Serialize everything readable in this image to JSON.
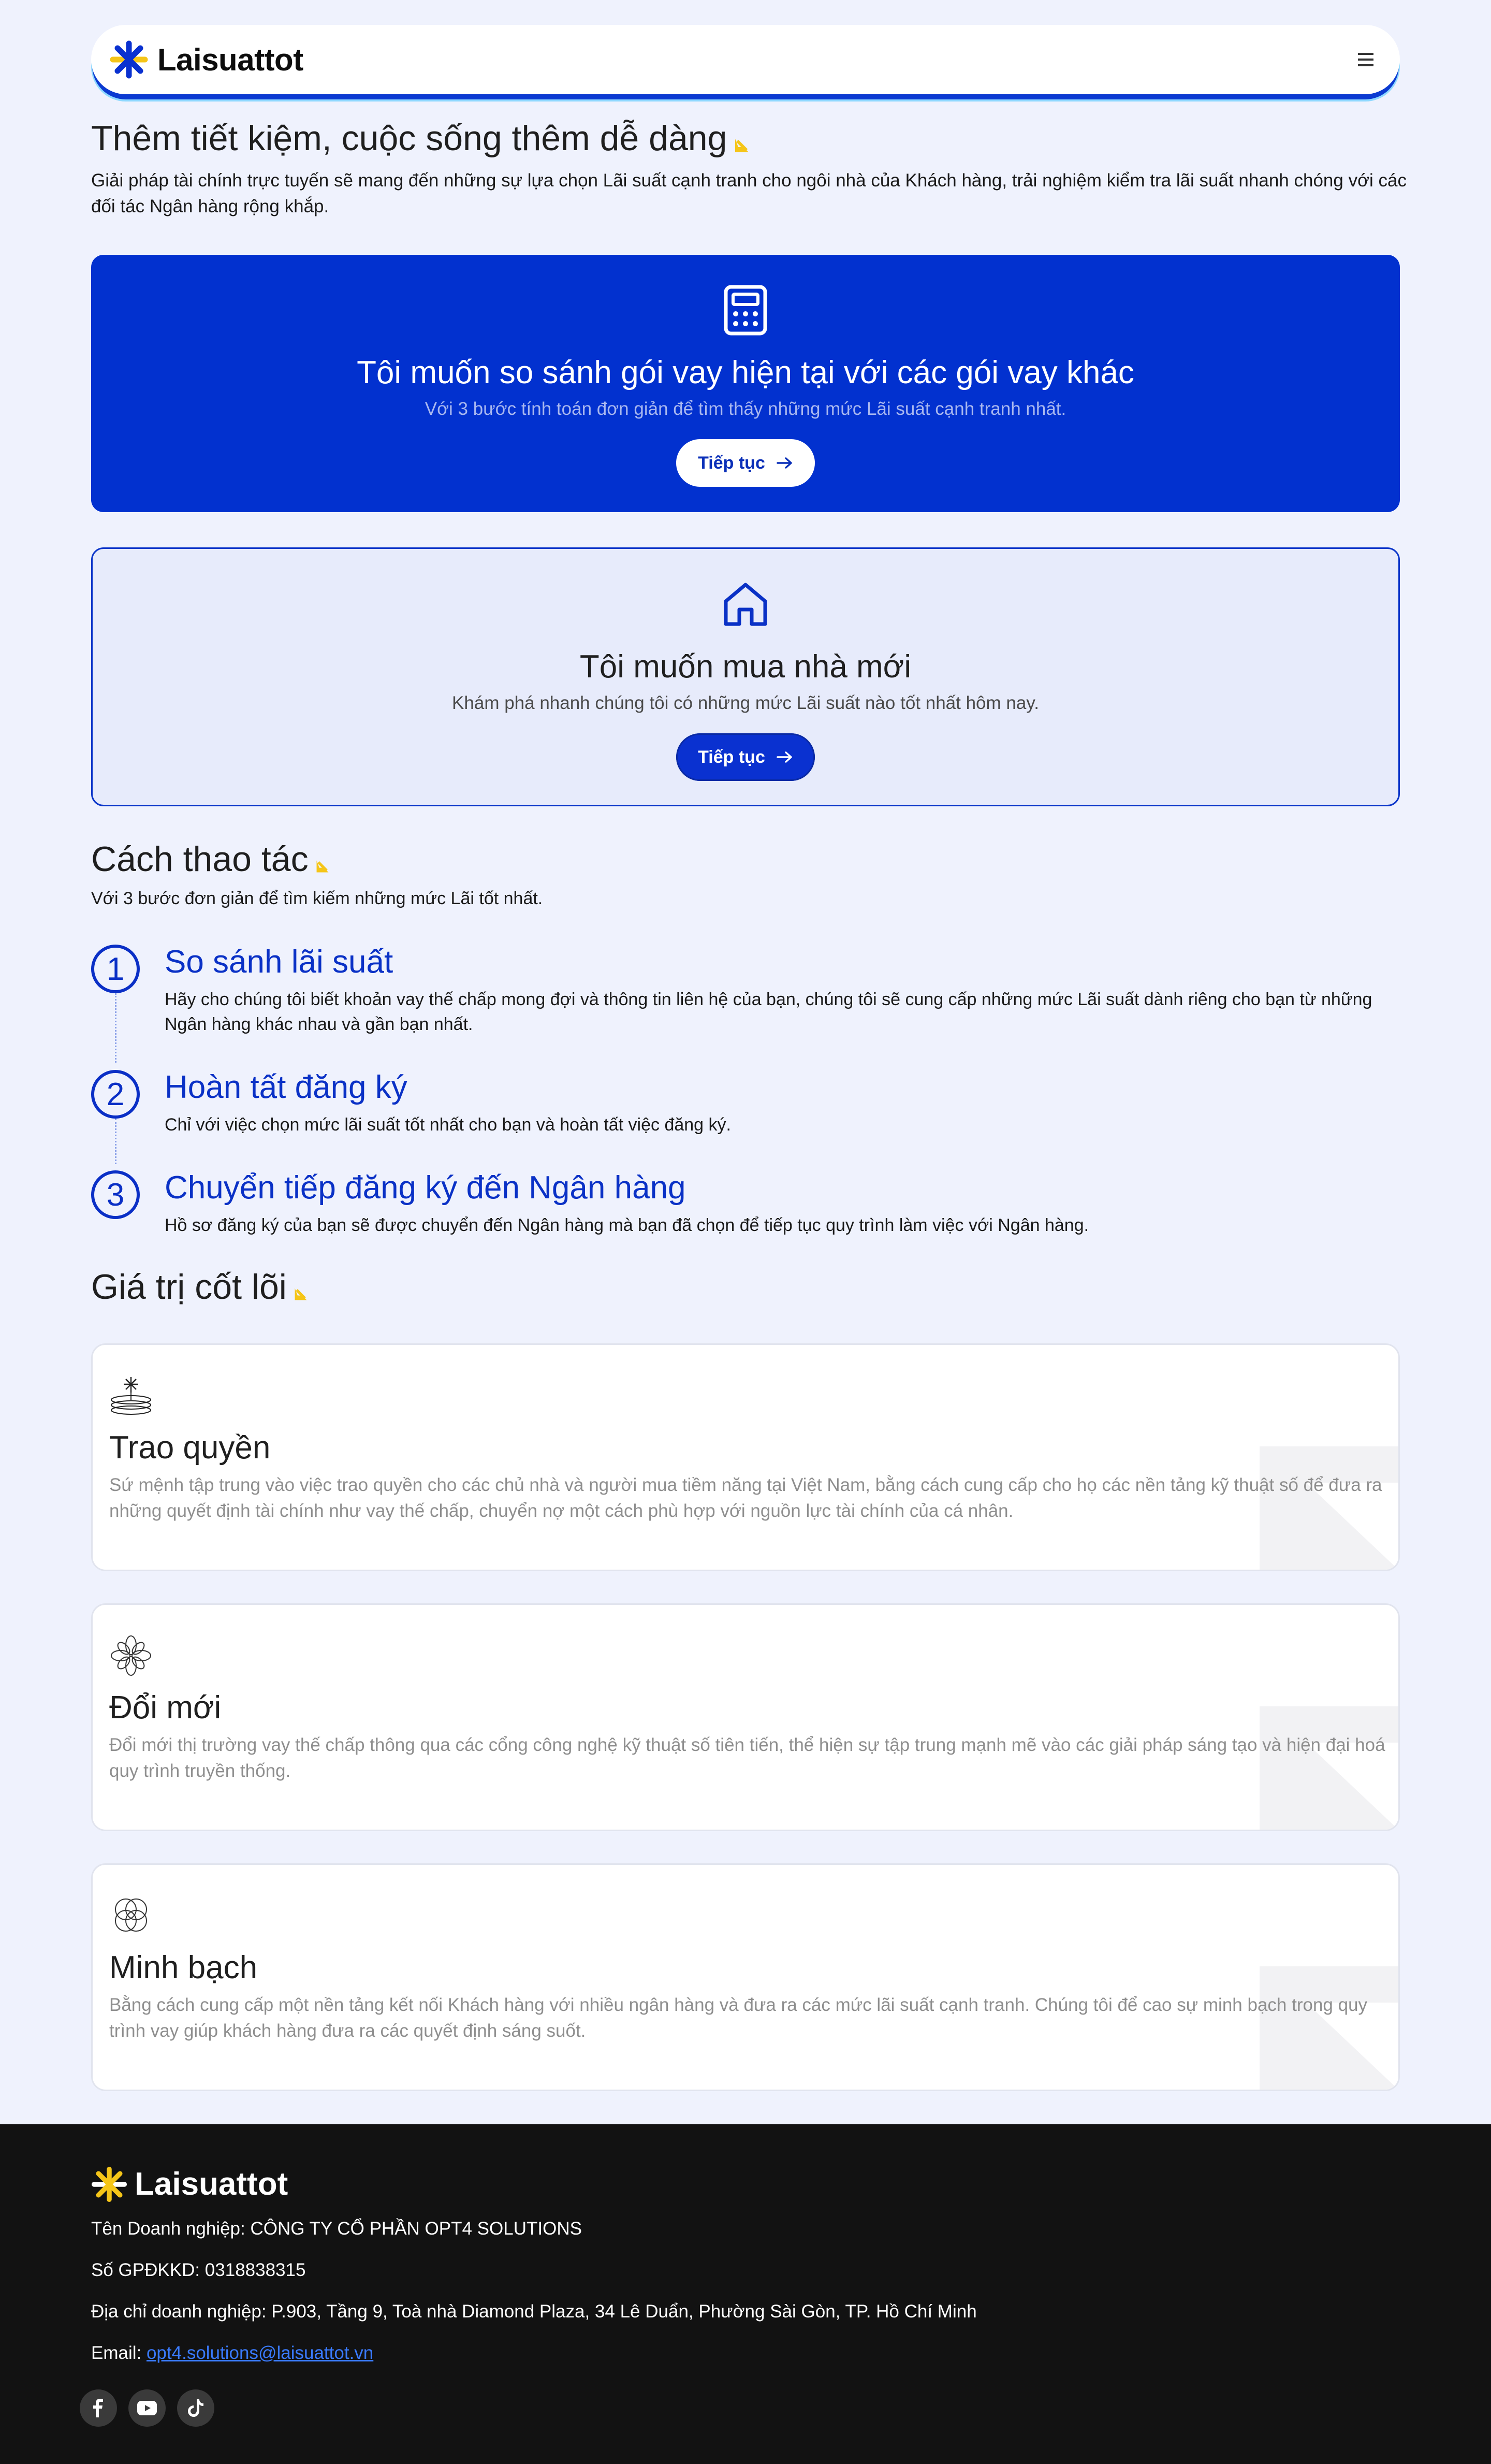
{
  "header": {
    "brand": "Laisuattot",
    "menu_icon": "hamburger-menu-icon"
  },
  "intro": {
    "title": "Thêm tiết kiệm, cuộc sống thêm dễ dàng",
    "description": "Giải pháp tài chính trực tuyến sẽ mang đến những sự lựa chọn Lãi suất cạnh tranh cho ngôi nhà của Khách hàng, trải nghiệm kiểm tra lãi suất nhanh chóng với các đối tác Ngân hàng rộng khắp."
  },
  "cards": [
    {
      "icon": "calculator-icon",
      "title": "Tôi muốn so sánh gói vay hiện tại với các gói vay khác",
      "subtitle": "Với 3 bước tính toán đơn giản để tìm thấy những mức Lãi suất cạnh tranh nhất.",
      "button": "Tiếp tục"
    },
    {
      "icon": "house-icon",
      "title": "Tôi muốn mua nhà mới",
      "subtitle": "Khám phá nhanh chúng tôi có những mức Lãi suất nào tốt nhất hôm nay.",
      "button": "Tiếp tục"
    }
  ],
  "how": {
    "title": "Cách thao tác",
    "subtitle": "Với 3 bước đơn giản để tìm kiếm những mức Lãi tốt nhất.",
    "steps": [
      {
        "num": "1",
        "title": "So sánh lãi suất",
        "desc": "Hãy cho chúng tôi biết khoản vay thế chấp mong đợi và thông tin liên hệ của bạn, chúng tôi sẽ cung cấp những mức Lãi suất dành riêng cho bạn từ những Ngân hàng khác nhau và gần bạn nhất."
      },
      {
        "num": "2",
        "title": "Hoàn tất đăng ký",
        "desc": "Chỉ với việc chọn mức lãi suất tốt nhất cho bạn và hoàn tất việc đăng ký."
      },
      {
        "num": "3",
        "title": "Chuyển tiếp đăng ký đến Ngân hàng",
        "desc": "Hồ sơ đăng ký của bạn sẽ được chuyển đến Ngân hàng mà bạn đã chọn để tiếp tục quy trình làm việc với Ngân hàng."
      }
    ]
  },
  "core": {
    "title": "Giá trị cốt lõi",
    "values": [
      {
        "icon": "empower-icon",
        "title": "Trao quyền",
        "desc": "Sứ mệnh tập trung vào việc trao quyền cho các chủ nhà và người mua tiềm năng tại Việt Nam, bằng cách cung cấp cho họ các nền tảng kỹ thuật số để đưa ra những quyết định tài chính như vay thế chấp, chuyển nợ một cách phù hợp với nguồn lực tài chính của cá nhân."
      },
      {
        "icon": "flower-icon",
        "title": "Đổi mới",
        "desc": "Đổi mới thị trường vay thế chấp thông qua các cổng công nghệ kỹ thuật số tiên tiến, thể hiện sự tập trung mạnh mẽ vào các giải pháp sáng tạo và hiện đại hoá quy trình truyền thống."
      },
      {
        "icon": "overlapping-circles-icon",
        "title": "Minh bạch",
        "desc": "Bằng cách cung cấp một nền tảng kết nối Khách hàng với nhiều ngân hàng và đưa ra các mức lãi suất cạnh tranh. Chúng tôi để cao sự minh bạch trong quy trình vay giúp khách hàng đưa ra các quyết định sáng suốt."
      }
    ]
  },
  "footer": {
    "brand": "Laisuattot",
    "company": "Tên Doanh nghiệp: CÔNG TY CỔ PHẦN OPT4 SOLUTIONS",
    "license": "Số GPĐKKD: 0318838315",
    "address": "Địa chỉ doanh nghiệp: P.903, Tầng 9, Toà nhà Diamond Plaza, 34 Lê Duẩn, Phường Sài Gòn, TP. Hồ Chí Minh",
    "email_label": "Email: ",
    "email": "opt4.solutions@laisuattot.vn",
    "socials": [
      "facebook-icon",
      "youtube-icon",
      "tiktok-icon"
    ]
  },
  "colors": {
    "primary": "#0231cf",
    "accent_yellow": "#f5c518",
    "background": "#eff2fd",
    "footer_bg": "#121212"
  }
}
